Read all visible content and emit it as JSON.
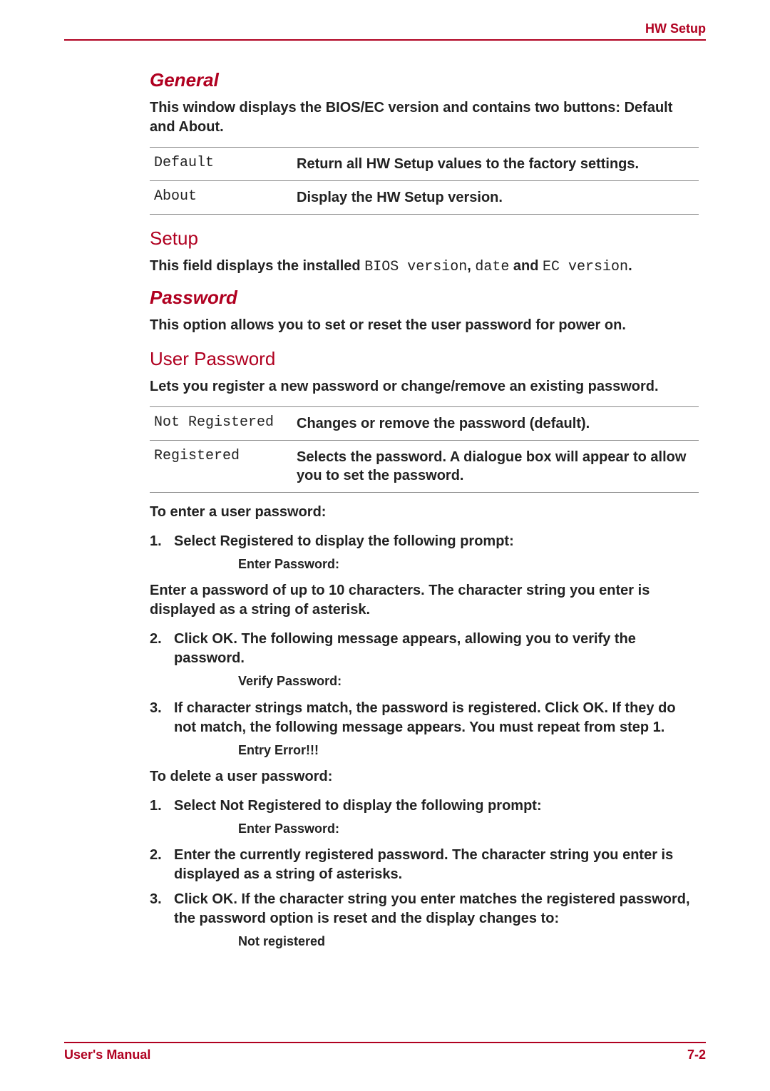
{
  "header": {
    "title": "HW Setup"
  },
  "sections": {
    "general": {
      "heading": "General",
      "intro": "This window displays the BIOS/EC version and contains two buttons: Default and About.",
      "rows": [
        {
          "key": "Default",
          "val": "Return all HW Setup values to the factory settings."
        },
        {
          "key": "About",
          "val": "Display the HW Setup version."
        }
      ]
    },
    "setup": {
      "heading": "Setup",
      "line_pre": "This field displays the installed ",
      "bios": "BIOS version",
      "comma": ", ",
      "date": "date",
      "and": " and ",
      "ec": "EC version",
      "dot": "."
    },
    "password": {
      "heading": "Password",
      "intro": "This option allows you to set or reset the user password for power on."
    },
    "userpass": {
      "heading": "User Password",
      "intro": "Lets you register a new password or change/remove an existing password.",
      "rows": [
        {
          "key": "Not Registered",
          "val": "Changes or remove the password (default)."
        },
        {
          "key": "Registered",
          "val": "Selects the password. A dialogue box will appear to allow you to set the password."
        }
      ],
      "enter_lead": "To enter a user password:",
      "enter_steps": {
        "s1_a": "Select ",
        "s1_b": "Registered",
        "s1_c": " to display the following prompt:",
        "s1_sub": "Enter Password:",
        "after1": "Enter a password of up to 10 characters. The character string you enter is displayed as a string of asterisk.",
        "s2_a": "Click ",
        "s2_b": "OK",
        "s2_c": ". The following message appears, allowing you to verify the password.",
        "s2_sub": "Verify Password:",
        "s3_a": "If character strings match, the password is registered. Click ",
        "s3_b": "OK",
        "s3_c": ". If they do not match, the following message appears. You must repeat from step 1.",
        "s3_sub": "Entry Error!!!"
      },
      "delete_lead": "To delete a user password:",
      "delete_steps": {
        "s1_a": "Select ",
        "s1_b": "Not Registered",
        "s1_c": " to display the following prompt:",
        "s1_sub": "Enter Password:",
        "s2": "Enter the currently registered password. The character string you enter is displayed as a string of asterisks.",
        "s3_a": "Click ",
        "s3_b": "OK",
        "s3_c": ". If the character string you enter matches the registered password, the password option is reset and the display changes to:",
        "s3_sub": "Not registered"
      }
    }
  },
  "footer": {
    "left": "User's Manual",
    "right": "7-2"
  }
}
